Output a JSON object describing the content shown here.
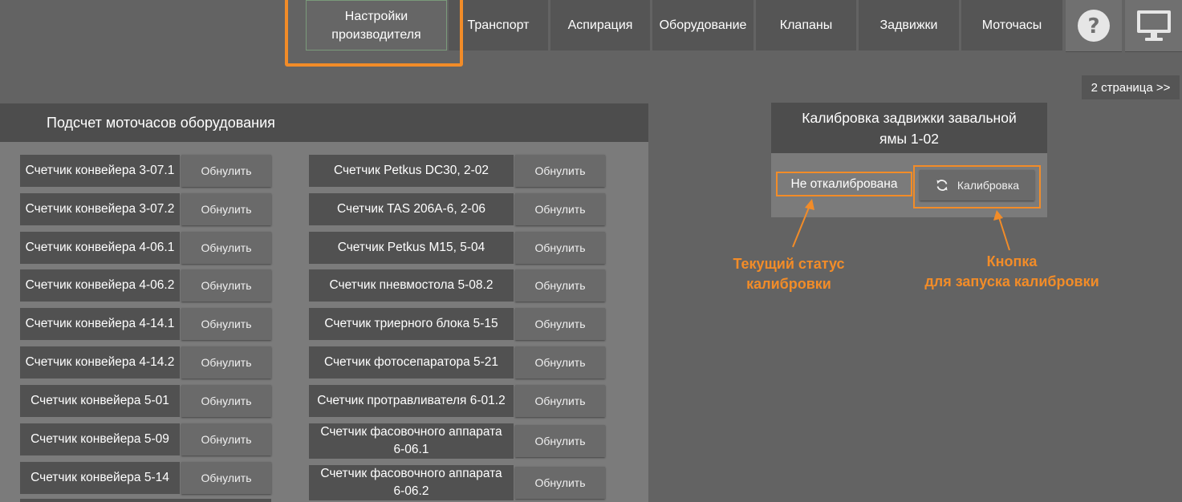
{
  "colors": {
    "accent": "#f28c28",
    "background": "#636363",
    "panel_body": "#7b7b7b",
    "label_bg": "#515151"
  },
  "nav": {
    "tabs": [
      {
        "label": "Настройки\nпроизводителя",
        "active": true
      },
      {
        "label": "Транспорт"
      },
      {
        "label": "Аспирация"
      },
      {
        "label": "Оборудование"
      },
      {
        "label": "Клапаны"
      },
      {
        "label": "Задвижки"
      },
      {
        "label": "Моточасы"
      }
    ],
    "help_icon": "question-circle-icon",
    "monitor_icon": "monitor-icon",
    "next_page_label": "2 страница >>"
  },
  "motor_hours": {
    "title": "Подсчет моточасов оборудования",
    "reset_label": "Обнулить",
    "left_counters": [
      "Счетчик конвейера 3-07.1",
      "Счетчик конвейера 3-07.2",
      "Счетчик конвейера 4-06.1",
      "Счетчик конвейера 4-06.2",
      "Счетчик конвейера 4-14.1",
      "Счетчик конвейера 4-14.2",
      "Счетчик конвейера 5-01",
      "Счетчик конвейера 5-09",
      "Счетчик конвейера 5-14"
    ],
    "right_counters": [
      "Счетчик Petkus DC30, 2-02",
      "Счетчик TAS 206A-6, 2-06",
      "Счетчик Petkus M15, 5-04",
      "Счетчик пневмостола 5-08.2",
      "Счетчик триерного блока 5-15",
      "Счетчик фотосепаратора 5-21",
      "Счетчик протравливателя 6-01.2",
      "Счетчик фасовочного аппарата 6-06.1",
      "Счетчик фасовочного аппарата 6-06.2"
    ]
  },
  "calibration": {
    "title": "Калибровка задвижки завальной\nямы 1-02",
    "status": "Не откалибрована",
    "button_label": "Калибровка",
    "button_icon": "refresh-icon",
    "annotation_status": "Текущий статус\nкалибровки",
    "annotation_button": "Кнопка\nдля запуска калибровки"
  }
}
